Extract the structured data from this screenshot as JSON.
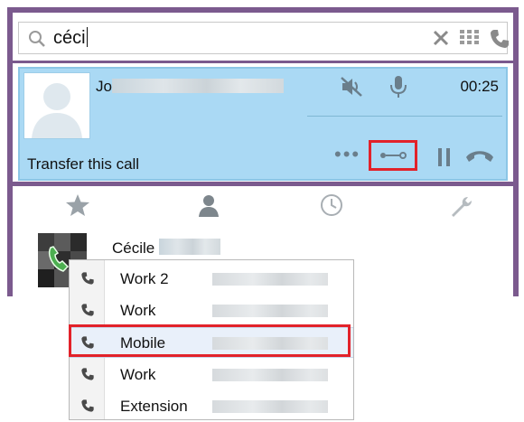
{
  "search": {
    "query": "céci"
  },
  "call": {
    "caller_name": "Jo",
    "timer": "00:25",
    "transfer_label": "Transfer this call",
    "more_label": "•••"
  },
  "contact": {
    "name": "Cécile"
  },
  "phone_list": [
    {
      "label": "Work 2"
    },
    {
      "label": "Work"
    },
    {
      "label": "Mobile"
    },
    {
      "label": "Work"
    },
    {
      "label": "Extension"
    }
  ],
  "colors": {
    "frame": "#7b5a8e",
    "call_panel": "#aad9f4",
    "highlight_box": "#e2222a",
    "icon_grey": "#6a7e8b"
  },
  "icons": [
    "search-icon",
    "clear-icon",
    "dialpad-icon",
    "phone-icon",
    "speaker-mute-icon",
    "microphone-icon",
    "more-icon",
    "transfer-icon",
    "pause-icon",
    "hang-up-icon",
    "favorites-star-icon",
    "contacts-person-icon",
    "history-clock-icon",
    "settings-wrench-icon"
  ]
}
